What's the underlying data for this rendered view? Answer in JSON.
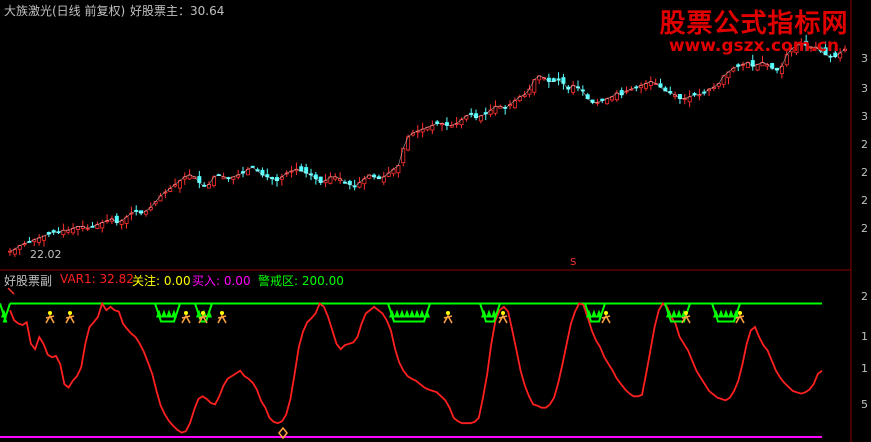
{
  "main_panel": {
    "title": "大族激光(日线 前复权)",
    "indicator_label": "好股票主：30.64",
    "low_label": "22.02",
    "marker_label": "S"
  },
  "sub_panel": {
    "title": "好股票副",
    "var1_label": "VAR1: 32.82",
    "focus_label": "关注: 0.00",
    "buy_label": "买入: 0.00",
    "warn_label": "警戒区: 200.00"
  },
  "watermark": {
    "line1": "股票公式指标网",
    "line2": "www.gszx.com.cn"
  },
  "axis": {
    "main_ticks": [
      "3",
      "3",
      "3",
      "2",
      "2",
      "2",
      "2"
    ],
    "sub_ticks": [
      "2",
      "1",
      "1",
      "5"
    ]
  },
  "colors": {
    "background": "#000000",
    "up_candle": "#ff3030",
    "down_candle": "#54ffff",
    "var1": "#ff2020",
    "focus": "#ffff00",
    "buy": "#ff00ff",
    "warn": "#00ff00",
    "title": "#c0c0c0",
    "watermark": "#e00000"
  },
  "chart_data": [
    {
      "type": "candlestick",
      "title": "大族激光(日线 前复权)",
      "series": [
        {
          "name": "好股票主",
          "last": 30.64
        }
      ],
      "visible_low": 22.02,
      "close": [
        22.0,
        22.1,
        22.3,
        22.4,
        22.5,
        22.6,
        22.7,
        22.8,
        22.9,
        23.0,
        23.0,
        23.1,
        23.1,
        23.2,
        23.3,
        23.3,
        23.2,
        23.3,
        23.4,
        23.5,
        23.6,
        23.7,
        23.5,
        23.6,
        23.8,
        24.0,
        24.1,
        24.0,
        24.1,
        24.3,
        24.6,
        24.9,
        25.1,
        25.3,
        25.5,
        25.7,
        25.9,
        26.0,
        25.9,
        25.6,
        25.4,
        25.5,
        25.9,
        26.0,
        25.9,
        25.8,
        25.9,
        26.0,
        26.1,
        26.3,
        26.4,
        26.2,
        26.0,
        25.9,
        25.8,
        25.7,
        25.9,
        26.1,
        26.2,
        26.3,
        26.2,
        26.1,
        26.0,
        25.8,
        25.6,
        25.7,
        25.9,
        25.9,
        25.8,
        25.6,
        25.5,
        25.4,
        25.6,
        25.8,
        26.0,
        25.9,
        25.8,
        25.9,
        26.1,
        26.3,
        26.5,
        27.4,
        28.0,
        28.2,
        28.3,
        28.4,
        28.5,
        28.6,
        28.7,
        28.7,
        28.6,
        28.6,
        28.7,
        28.9,
        29.1,
        29.2,
        29.0,
        29.1,
        29.2,
        29.4,
        29.6,
        29.6,
        29.5,
        29.7,
        29.9,
        30.1,
        30.2,
        30.5,
        31.0,
        31.2,
        31.1,
        30.9,
        30.9,
        31.0,
        30.8,
        30.5,
        30.7,
        30.6,
        30.4,
        30.0,
        29.8,
        29.8,
        29.9,
        30.0,
        30.1,
        30.3,
        30.2,
        30.4,
        30.5,
        30.6,
        30.7,
        30.8,
        30.9,
        30.8,
        30.6,
        30.4,
        30.3,
        30.2,
        30.0,
        30.0,
        30.1,
        30.2,
        30.2,
        30.3,
        30.5,
        30.6,
        30.8,
        31.2,
        31.4,
        31.6,
        31.7,
        31.8,
        31.9,
        31.7,
        31.8,
        31.9,
        31.8,
        31.6,
        31.5,
        31.7,
        32.3,
        32.6,
        32.8,
        32.9,
        32.8,
        32.7,
        32.7,
        32.5,
        32.3,
        32.2,
        32.2,
        32.4,
        32.6
      ]
    },
    {
      "type": "line",
      "title": "好股票副",
      "ylim": [
        0,
        220
      ],
      "series": [
        {
          "name": "VAR1",
          "last": 32.82,
          "values": [
            190,
            175,
            170,
            168,
            172,
            140,
            132,
            150,
            140,
            124,
            120,
            122,
            110,
            80,
            75,
            85,
            92,
            105,
            140,
            165,
            172,
            180,
            200,
            190,
            195,
            190,
            188,
            170,
            162,
            155,
            150,
            140,
            128,
            112,
            95,
            70,
            48,
            35,
            25,
            18,
            12,
            8,
            10,
            22,
            42,
            58,
            62,
            58,
            52,
            50,
            62,
            78,
            88,
            92,
            96,
            100,
            92,
            88,
            82,
            72,
            55,
            45,
            30,
            24,
            22,
            25,
            35,
            58,
            95,
            135,
            158,
            172,
            178,
            185,
            200,
            195,
            180,
            160,
            140,
            132,
            138,
            140,
            142,
            150,
            170,
            185,
            190,
            195,
            190,
            185,
            175,
            160,
            132,
            112,
            100,
            92,
            88,
            85,
            80,
            75,
            72,
            70,
            68,
            62,
            56,
            45,
            30,
            25,
            22,
            22,
            22,
            24,
            30,
            60,
            95,
            140,
            175,
            190,
            195,
            188,
            160,
            130,
            100,
            78,
            62,
            50,
            48,
            45,
            45,
            50,
            60,
            82,
            110,
            140,
            170,
            188,
            200,
            198,
            180,
            160,
            145,
            135,
            120,
            110,
            100,
            88,
            80,
            72,
            66,
            62,
            62,
            64,
            96,
            130,
            165,
            190,
            200,
            195,
            180,
            170,
            150,
            140,
            130,
            115,
            100,
            90,
            80,
            70,
            65,
            60,
            58,
            56,
            60,
            70,
            85,
            110,
            140,
            160,
            165,
            150,
            138,
            130,
            115,
            100,
            90,
            82,
            76,
            70,
            68,
            66,
            68,
            72,
            80,
            95,
            100
          ]
        },
        {
          "name": "关注",
          "last": 0.0
        },
        {
          "name": "买入",
          "last": 0.0
        },
        {
          "name": "警戒区",
          "last": 200.0
        }
      ]
    }
  ]
}
